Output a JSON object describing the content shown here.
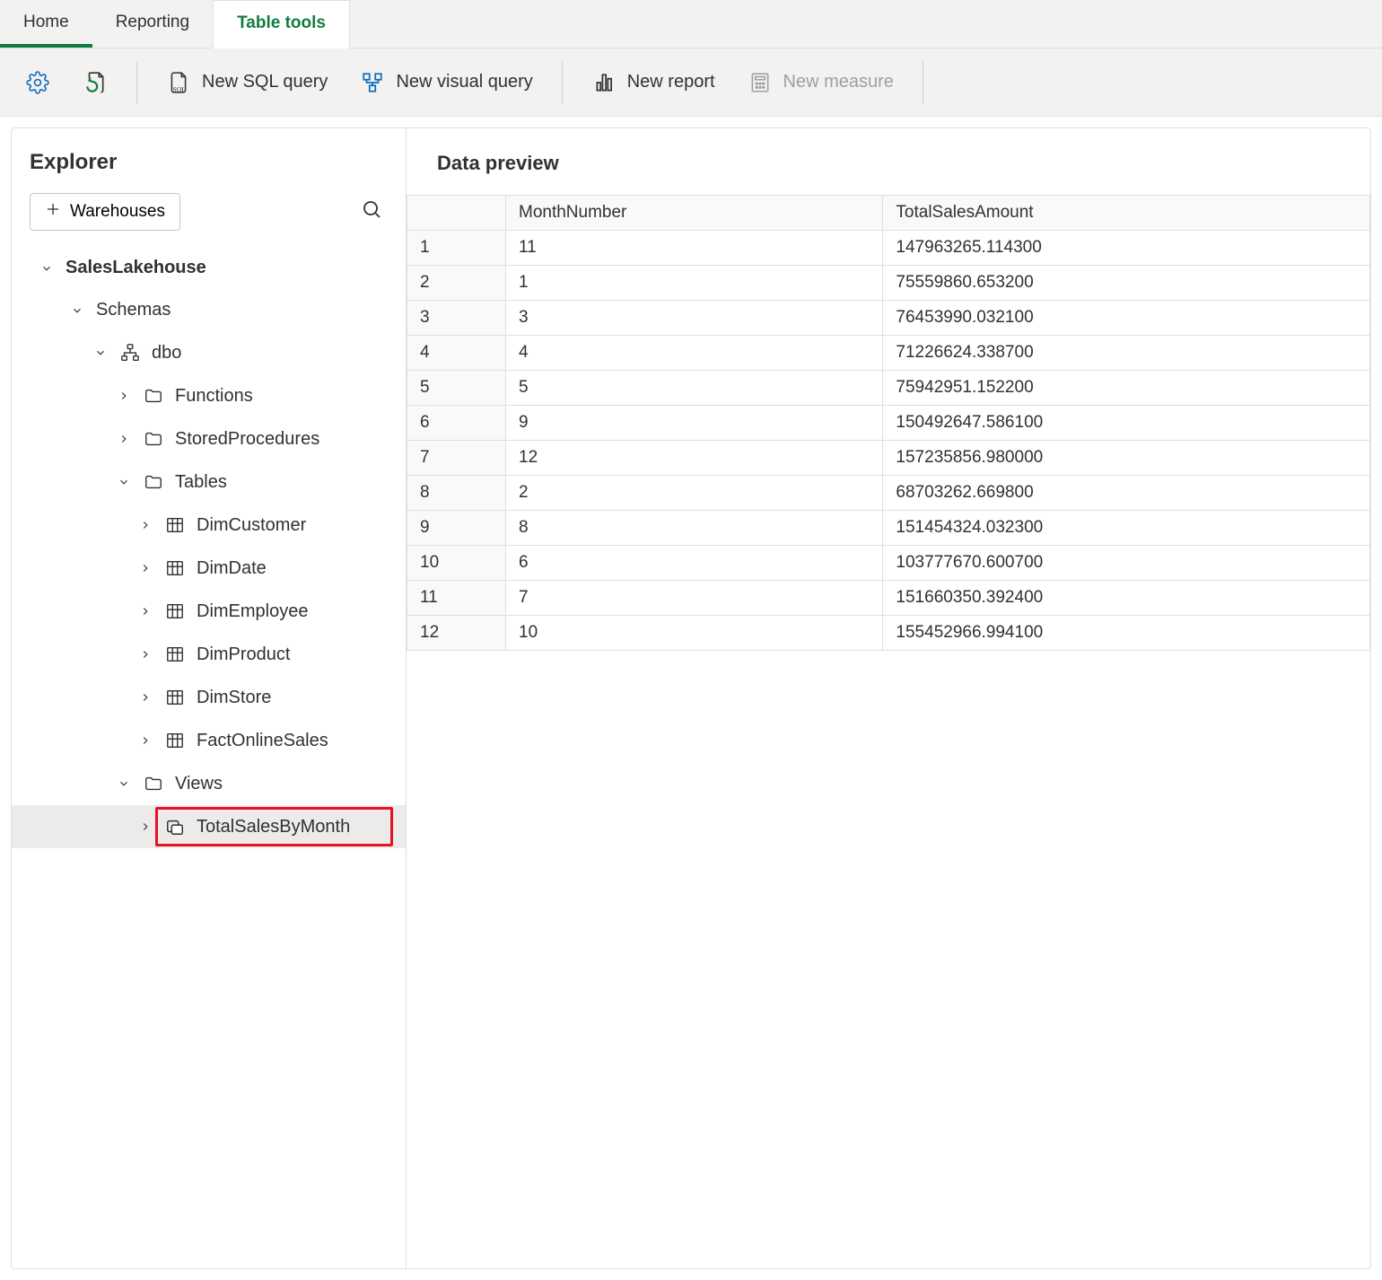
{
  "ribbon": {
    "tabs": [
      "Home",
      "Reporting",
      "Table tools"
    ],
    "selectedIndex": 0,
    "activeToolsIndex": 2
  },
  "toolbar": {
    "newSqlQuery": "New SQL query",
    "newVisualQuery": "New visual query",
    "newReport": "New report",
    "newMeasure": "New measure"
  },
  "explorer": {
    "title": "Explorer",
    "warehousesBtn": "Warehouses",
    "tree": {
      "root": "SalesLakehouse",
      "schemas": "Schemas",
      "dbo": "dbo",
      "functions": "Functions",
      "storedProcedures": "StoredProcedures",
      "tablesLabel": "Tables",
      "tables": [
        "DimCustomer",
        "DimDate",
        "DimEmployee",
        "DimProduct",
        "DimStore",
        "FactOnlineSales"
      ],
      "viewsLabel": "Views",
      "views": [
        "TotalSalesByMonth"
      ]
    }
  },
  "preview": {
    "title": "Data preview",
    "columns": [
      "MonthNumber",
      "TotalSalesAmount"
    ],
    "rows": [
      {
        "n": "1",
        "MonthNumber": "11",
        "TotalSalesAmount": "147963265.114300"
      },
      {
        "n": "2",
        "MonthNumber": "1",
        "TotalSalesAmount": "75559860.653200"
      },
      {
        "n": "3",
        "MonthNumber": "3",
        "TotalSalesAmount": "76453990.032100"
      },
      {
        "n": "4",
        "MonthNumber": "4",
        "TotalSalesAmount": "71226624.338700"
      },
      {
        "n": "5",
        "MonthNumber": "5",
        "TotalSalesAmount": "75942951.152200"
      },
      {
        "n": "6",
        "MonthNumber": "9",
        "TotalSalesAmount": "150492647.586100"
      },
      {
        "n": "7",
        "MonthNumber": "12",
        "TotalSalesAmount": "157235856.980000"
      },
      {
        "n": "8",
        "MonthNumber": "2",
        "TotalSalesAmount": "68703262.669800"
      },
      {
        "n": "9",
        "MonthNumber": "8",
        "TotalSalesAmount": "151454324.032300"
      },
      {
        "n": "10",
        "MonthNumber": "6",
        "TotalSalesAmount": "103777670.600700"
      },
      {
        "n": "11",
        "MonthNumber": "7",
        "TotalSalesAmount": "151660350.392400"
      },
      {
        "n": "12",
        "MonthNumber": "10",
        "TotalSalesAmount": "155452966.994100"
      }
    ]
  }
}
